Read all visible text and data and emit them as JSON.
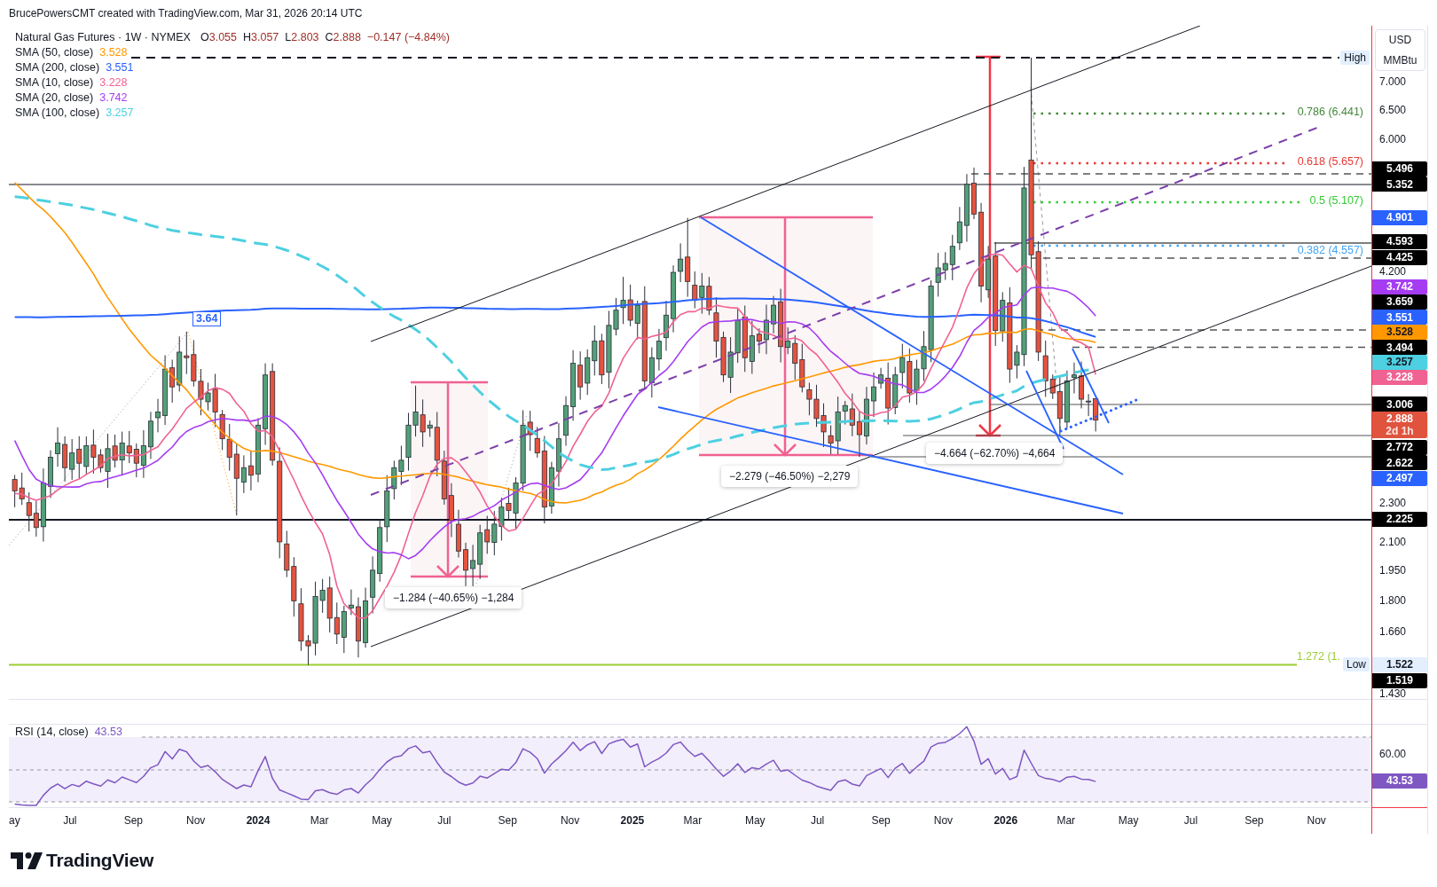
{
  "header": {
    "attribution": "BrucePowersCMT created with TradingView.com, Mar 31, 2026 20:14 UTC"
  },
  "legend": {
    "symbol": "Natural Gas Futures · 1W · NYMEX",
    "ohlc": [
      {
        "label": "O",
        "value": "3.055"
      },
      {
        "label": "H",
        "value": "3.057"
      },
      {
        "label": "L",
        "value": "2.803"
      },
      {
        "label": "C",
        "value": "2.888"
      }
    ],
    "change": "−0.147 (−4.84%)",
    "indicators": [
      {
        "name": "SMA (50, close)",
        "value": "3.528",
        "color": "#ff9800"
      },
      {
        "name": "SMA (200, close)",
        "value": "3.551",
        "color": "#2962ff"
      },
      {
        "name": "SMA (10, close)",
        "value": "3.228",
        "color": "#f06292"
      },
      {
        "name": "SMA (20, close)",
        "value": "3.742",
        "color": "#a53cf2"
      },
      {
        "name": "SMA (100, close)",
        "value": "3.257",
        "color": "#4dd0e1"
      }
    ]
  },
  "chart": {
    "callout": "3.64",
    "high_label": "High",
    "low_label": "Low",
    "fib_levels": [
      {
        "label": "0.786 (6.441)",
        "color": "#43883a"
      },
      {
        "label": "0.618 (5.657)",
        "color": "#e53935"
      },
      {
        "label": "0.5 (5.107)",
        "color": "#37c837"
      },
      {
        "label": "0.382 (4.557)",
        "color": "#42a5f5"
      },
      {
        "label": "1.272 (1.",
        "color": "#9acd32"
      }
    ],
    "measures": [
      {
        "label": "−1.284 (−40.65%) −1,284",
        "color": "#f06292"
      },
      {
        "label": "−2.279 (−46.50%) −2,279",
        "color": "#f06292"
      },
      {
        "label": "−4.664 (−62.70%) −4,664",
        "color": "#f23645"
      }
    ]
  },
  "price_axis": {
    "currency": "USD",
    "unit": "MMBtu",
    "ticks": [
      "7.000",
      "6.500",
      "6.000",
      "4.200",
      "2.300",
      "2.100",
      "1.950",
      "1.800",
      "1.660",
      "1.430"
    ],
    "badges": [
      {
        "value": "5.496",
        "color": "#000000"
      },
      {
        "value": "5.352",
        "color": "#000000"
      },
      {
        "value": "4.901",
        "color": "#2962ff"
      },
      {
        "value": "4.593",
        "color": "#000000"
      },
      {
        "value": "4.425",
        "color": "#000000"
      },
      {
        "value": "3.742",
        "color": "#a53cf2"
      },
      {
        "value": "3.659",
        "color": "#000000"
      },
      {
        "value": "3.551",
        "color": "#2962ff"
      },
      {
        "value": "3.528",
        "color": "#ff9800"
      },
      {
        "value": "3.494",
        "color": "#000000"
      },
      {
        "value": "3.257",
        "color": "#4dd0e1"
      },
      {
        "value": "3.228",
        "color": "#f06292"
      },
      {
        "value": "3.006",
        "color": "#000000"
      },
      {
        "value": "2.888",
        "countdown": "2d 1h",
        "color": "#e0533d"
      },
      {
        "value": "2.772",
        "color": "#000000"
      },
      {
        "value": "2.622",
        "color": "#000000"
      },
      {
        "value": "2.497",
        "color": "#2962ff"
      },
      {
        "value": "2.225",
        "color": "#000000"
      },
      {
        "value": "1.522",
        "color": "#e3effd"
      },
      {
        "value": "1.519",
        "color": "#000000"
      }
    ]
  },
  "rsi": {
    "name": "RSI (14, close)",
    "value": "43.53",
    "ticks": [
      "60.00"
    ],
    "badge": "43.53"
  },
  "time_axis": {
    "labels": [
      {
        "text": "ay",
        "kind": "month"
      },
      {
        "text": "Jul",
        "kind": "month"
      },
      {
        "text": "Sep",
        "kind": "month"
      },
      {
        "text": "Nov",
        "kind": "month"
      },
      {
        "text": "2024",
        "kind": "year"
      },
      {
        "text": "Mar",
        "kind": "month"
      },
      {
        "text": "May",
        "kind": "month"
      },
      {
        "text": "Jul",
        "kind": "month"
      },
      {
        "text": "Sep",
        "kind": "month"
      },
      {
        "text": "Nov",
        "kind": "month"
      },
      {
        "text": "2025",
        "kind": "year"
      },
      {
        "text": "Mar",
        "kind": "month"
      },
      {
        "text": "May",
        "kind": "month"
      },
      {
        "text": "Jul",
        "kind": "month"
      },
      {
        "text": "Sep",
        "kind": "month"
      },
      {
        "text": "Nov",
        "kind": "month"
      },
      {
        "text": "2026",
        "kind": "year"
      },
      {
        "text": "Mar",
        "kind": "month"
      },
      {
        "text": "May",
        "kind": "month"
      },
      {
        "text": "Jul",
        "kind": "month"
      },
      {
        "text": "Sep",
        "kind": "month"
      },
      {
        "text": "Nov",
        "kind": "month"
      }
    ]
  },
  "footer": {
    "logo_text": "TradingView"
  }
}
